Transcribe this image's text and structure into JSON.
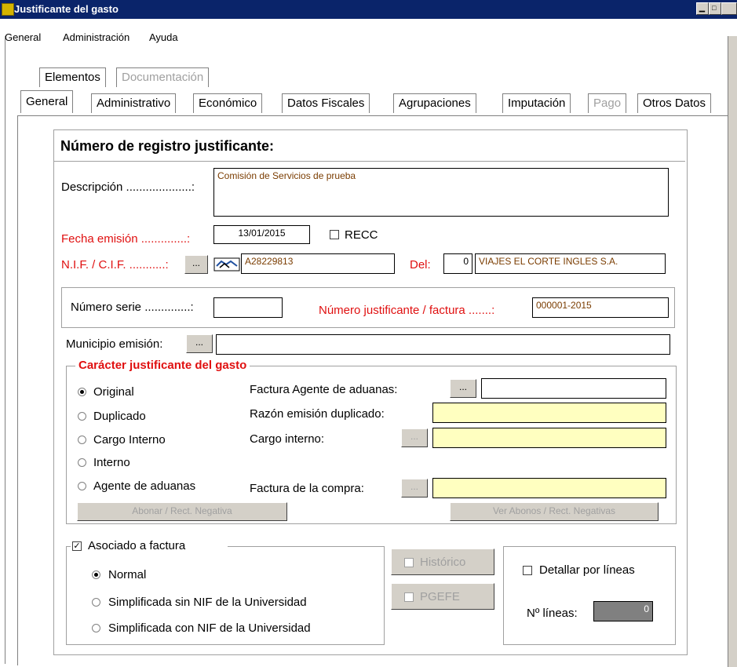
{
  "window": {
    "title": "Justificante del gasto"
  },
  "menu": [
    "General",
    "Administración",
    "Ayuda"
  ],
  "outer_tabs": [
    {
      "label": "Elementos",
      "disabled": false
    },
    {
      "label": "Documentación",
      "disabled": true
    }
  ],
  "inner_tabs": [
    {
      "label": "General",
      "active": true,
      "disabled": false
    },
    {
      "label": "Administrativo",
      "disabled": false
    },
    {
      "label": "Económico",
      "disabled": false
    },
    {
      "label": "Datos Fiscales",
      "disabled": false
    },
    {
      "label": "Agrupaciones",
      "disabled": false
    },
    {
      "label": "Imputación",
      "disabled": false
    },
    {
      "label": "Pago",
      "disabled": true
    },
    {
      "label": "Otros Datos",
      "disabled": false
    }
  ],
  "header": {
    "title": "Número de registro justificante:"
  },
  "form": {
    "descripcion_label": "Descripción ....................:",
    "descripcion_value": "Comisión de Servicios de prueba",
    "fecha_label": "Fecha emisión ..............:",
    "fecha_value": "13/01/2015",
    "recc_label": "RECC",
    "nif_label": "N.I.F. / C.I.F. ...........:",
    "nif_btn": "...",
    "nif_value": "A28229813",
    "del_label": "Del:",
    "del_value": "0",
    "razon_social": "VIAJES EL CORTE INGLES S.A.",
    "numserie_label": "Número serie ..............:",
    "numserie_value": "",
    "numjust_label": "Número justificante / factura .......:",
    "numjust_value": "000001-2015",
    "municipio_label": "Municipio emisión:",
    "municipio_btn": "...",
    "municipio_value": ""
  },
  "caracter": {
    "title": "Carácter justificante del gasto",
    "options": [
      "Original",
      "Duplicado",
      "Cargo Interno",
      "Interno",
      "Agente de aduanas"
    ],
    "selected": "Original",
    "factura_agente_label": "Factura Agente de aduanas:",
    "razon_dup_label": "Razón emisión duplicado:",
    "cargo_interno_label": "Cargo interno:",
    "factura_compra_label": "Factura de la compra:",
    "btn_dots": "...",
    "abonar_btn": "Abonar / Rect. Negativa",
    "ver_abonos_btn": "Ver Abonos / Rect. Negativas"
  },
  "asociado": {
    "label": "Asociado a factura",
    "checked": true,
    "options": [
      "Normal",
      "Simplificada sin NIF de la Universidad",
      "Simplificada con NIF de la Universidad"
    ],
    "selected": "Normal",
    "historico_label": "Histórico",
    "pgefe_label": "PGEFE"
  },
  "detalle": {
    "detallar_label": "Detallar por líneas",
    "nlineas_label": "Nº líneas:",
    "nlineas_value": "0"
  }
}
